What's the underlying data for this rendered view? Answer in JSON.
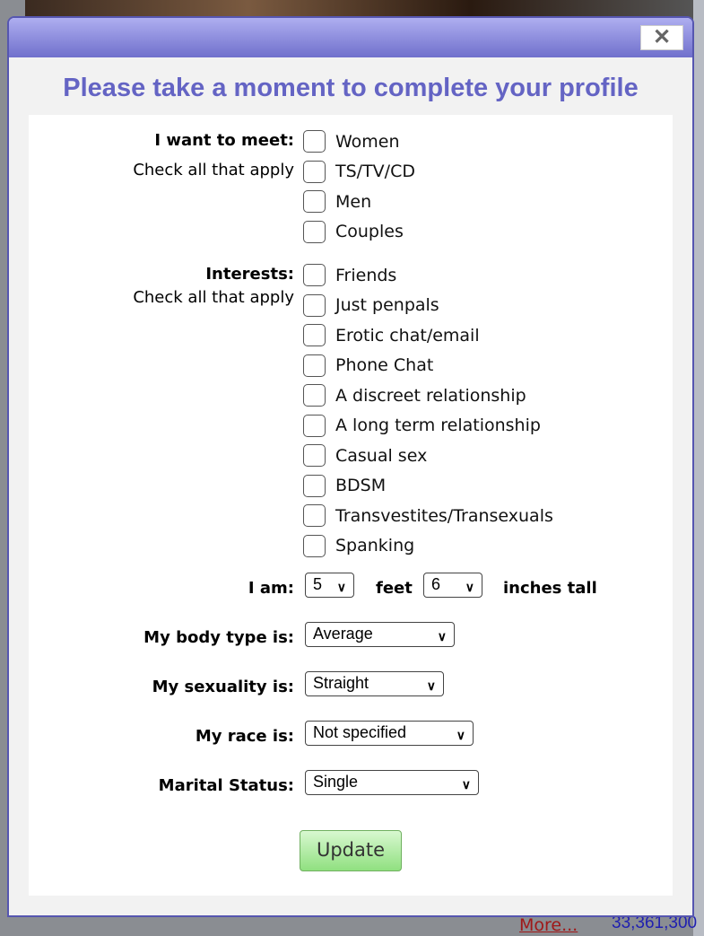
{
  "dialog": {
    "title": "Please take a moment to complete your profile",
    "close": "✕"
  },
  "meet": {
    "label": "I want to meet:",
    "hint": "Check all that apply",
    "options": [
      "Women",
      "TS/TV/CD",
      "Men",
      "Couples"
    ]
  },
  "interests": {
    "label": "Interests:",
    "hint": "Check all that apply",
    "options": [
      "Friends",
      "Just penpals",
      "Erotic chat/email",
      "Phone Chat",
      "A discreet relationship",
      "A long term relationship",
      "Casual sex",
      "BDSM",
      "Transvestites/Transexuals",
      "Spanking"
    ]
  },
  "height": {
    "label": "I am:",
    "feet_value": "5",
    "feet_label": "feet",
    "inches_value": "6",
    "inches_label": "inches tall"
  },
  "body_type": {
    "label": "My body type is:",
    "value": "Average"
  },
  "sexuality": {
    "label": "My sexuality is:",
    "value": "Straight"
  },
  "race": {
    "label": "My race is:",
    "value": "Not specified"
  },
  "marital": {
    "label": "Marital Status:",
    "value": "Single"
  },
  "update_label": "Update",
  "background": {
    "more_link": "More...",
    "count": "33,361,300"
  },
  "colors": {
    "accent": "#6464c4",
    "header_top": "#aeaef0",
    "header_bottom": "#7070cc",
    "button": "#90e080"
  }
}
